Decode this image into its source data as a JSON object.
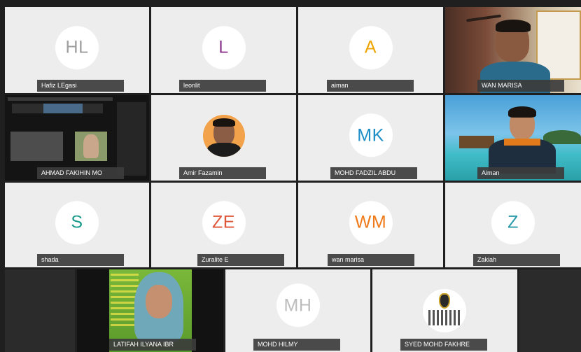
{
  "participants": [
    {
      "name": "Hafiz LEgasi",
      "initials": "HL",
      "color": "#9e9e9e",
      "type": "initials"
    },
    {
      "name": "leonlit",
      "initials": "L",
      "color": "#8e3a8e",
      "type": "initials"
    },
    {
      "name": "aiman",
      "initials": "A",
      "color": "#f0a400",
      "type": "initials"
    },
    {
      "name": "WAN MARISA",
      "type": "video"
    },
    {
      "name": "AHMAD FAKIHIN MO",
      "type": "screenshare"
    },
    {
      "name": "Amir Fazamin",
      "type": "photo"
    },
    {
      "name": "MOHD FADZIL ABDU",
      "initials": "MK",
      "color": "#1e8fc7",
      "type": "initials"
    },
    {
      "name": "Aiman",
      "type": "video-beach"
    },
    {
      "name": "shada",
      "initials": "S",
      "color": "#1a9a8a",
      "type": "initials"
    },
    {
      "name": "Zuralite E",
      "initials": "ZE",
      "color": "#e0563a",
      "type": "initials"
    },
    {
      "name": "wan marisa",
      "initials": "WM",
      "color": "#f07a1a",
      "type": "initials"
    },
    {
      "name": "Zakiah",
      "initials": "Z",
      "color": "#2a9aa8",
      "type": "initials"
    },
    {
      "name": "LATIFAH ILYANA IBR",
      "type": "video-poster"
    },
    {
      "name": "MOHD HILMY",
      "initials": "MH",
      "color": "#bdbdbd",
      "type": "initials"
    },
    {
      "name": "SYED MOHD FAKHRE",
      "type": "logo"
    }
  ],
  "screenshare": {
    "tile_label": "WAN MARISA"
  },
  "colors": {
    "tile_bg": "#ededed",
    "label_bg": "#3c3c3c",
    "border": "#1f1f1f"
  }
}
